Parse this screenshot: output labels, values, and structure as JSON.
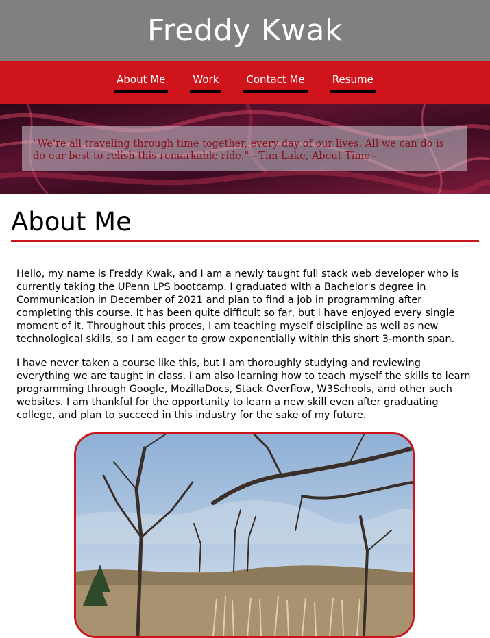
{
  "header": {
    "title": "Freddy Kwak"
  },
  "nav": {
    "items": [
      {
        "label": "About Me"
      },
      {
        "label": "Work"
      },
      {
        "label": "Contact Me"
      },
      {
        "label": "Resume"
      }
    ]
  },
  "hero": {
    "quote": "\"We're all traveling through time together, every day of our lives. All we can do is do our best to relish this remarkable ride.\" - Tim Lake, About Time -"
  },
  "about": {
    "heading": "About Me",
    "paragraphs": [
      "Hello, my name is Freddy Kwak, and I am a newly taught full stack web developer who is currently taking the UPenn LPS bootcamp. I graduated with a Bachelor's degree in Communication in December of 2021 and plan to find a job in programming after completing this course. It has been quite difficult so far, but I have enjoyed every single moment of it. Throughout this proces, I am teaching myself discipline as well as new technological skills, so I am eager to grow exponentially within this short 3-month span.",
      "I have never taken a course like this, but I am thoroughly studying and reviewing everything we are taught in class. I am also learning how to teach myself the skills to learn programming through Google, MozillaDocs, Stack Overflow, W3Schools, and other such websites. I am thankful for the opportunity to learn a new skill even after graduating college, and plan to succeed in this industry for the sake of my future."
    ]
  },
  "colors": {
    "accent": "#d0141b",
    "title_bar": "#808080",
    "nav_underline": "#000000"
  }
}
